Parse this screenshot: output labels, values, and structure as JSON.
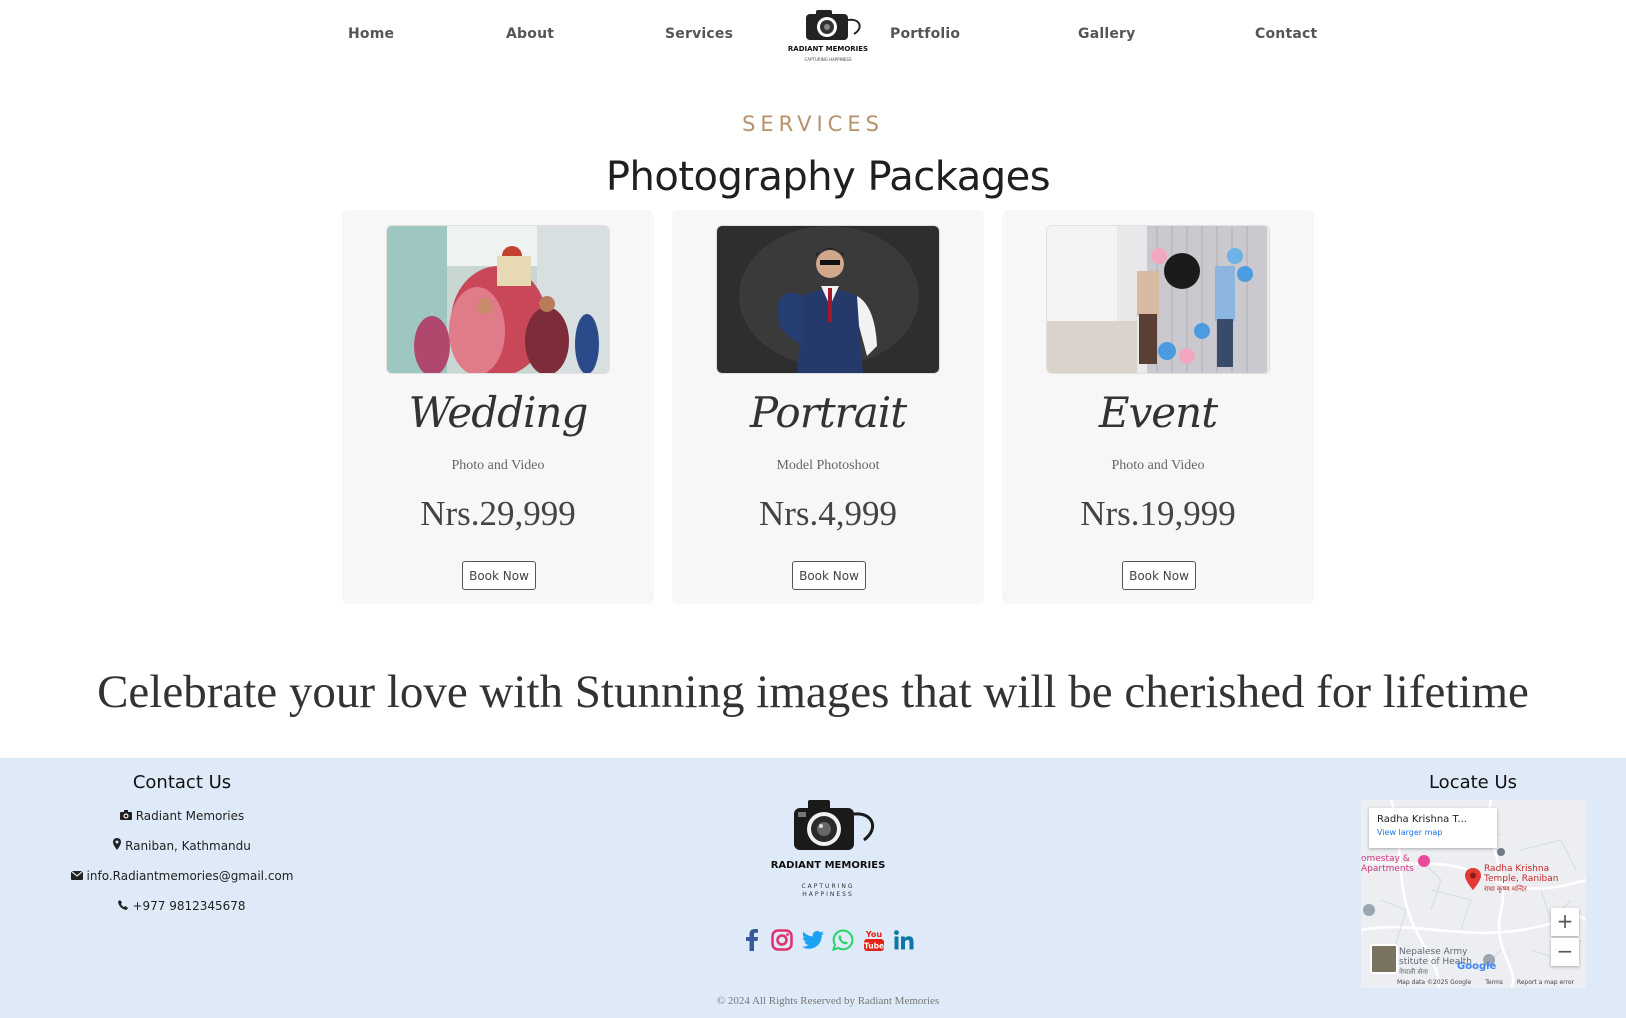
{
  "nav": {
    "links": [
      "Home",
      "About",
      "Services",
      "Portfolio",
      "Gallery",
      "Contact"
    ],
    "logo_text": "RADIANT MEMORIES",
    "logo_tagline": "CAPTURING HAPPINESS"
  },
  "services": {
    "eyebrow": "SERVICES",
    "title": "Photography Packages",
    "cards": [
      {
        "title": "Wedding",
        "subtitle": "Photo and Video",
        "price": "Nrs.29,999",
        "button": "Book Now"
      },
      {
        "title": "Portrait",
        "subtitle": "Model Photoshoot",
        "price": "Nrs.4,999",
        "button": "Book Now"
      },
      {
        "title": "Event",
        "subtitle": "Photo and Video",
        "price": "Nrs.19,999",
        "button": "Book Now"
      }
    ]
  },
  "tagline": "Celebrate your love with Stunning images that will be cherished for lifetime",
  "footer": {
    "contact": {
      "heading": "Contact Us",
      "items": [
        {
          "icon": "camera-icon",
          "text": "Radiant Memories"
        },
        {
          "icon": "map-marker-icon",
          "text": "Raniban, Kathmandu"
        },
        {
          "icon": "envelope-icon",
          "text": "info.Radiantmemories@gmail.com"
        },
        {
          "icon": "phone-icon",
          "text": "+977 9812345678"
        }
      ]
    },
    "logo_text": "RADIANT MEMORIES",
    "logo_tagline_1": "CAPTURING",
    "logo_tagline_2": "HAPPINESS",
    "socials": [
      {
        "name": "facebook-icon",
        "color": "#3b5998"
      },
      {
        "name": "instagram-icon",
        "color": "#e1306c"
      },
      {
        "name": "twitter-icon",
        "color": "#1da1f2"
      },
      {
        "name": "whatsapp-icon",
        "color": "#25d366"
      },
      {
        "name": "youtube-icon",
        "color": "#e62117"
      },
      {
        "name": "linkedin-icon",
        "color": "#0e76a8"
      }
    ],
    "copyright": "© 2024 All Rights Reserved by Radiant Memories",
    "locate": {
      "heading": "Locate Us",
      "map_place": "Radha Krishna T...",
      "map_link": "View larger map",
      "pin_label_1": "Radha Krishna",
      "pin_label_2": "Temple, Raniban",
      "pin_label_3": "राधा कृष्ण मन्दिर",
      "poi_1a": "omestay &",
      "poi_1b": "Apartments",
      "poi_2a": "Nepalese Army",
      "poi_2b": "stitute of Health",
      "poi_2c": "नेपाली सेना",
      "google": "Google",
      "map_data": "Map data ©2025 Google",
      "terms": "Terms",
      "report": "Report a map error",
      "zoom_in": "+",
      "zoom_out": "−"
    }
  },
  "colors": {
    "accent": "#b6916a",
    "footer_bg": "#deeaf7",
    "card_bg": "#f7f7f7"
  }
}
